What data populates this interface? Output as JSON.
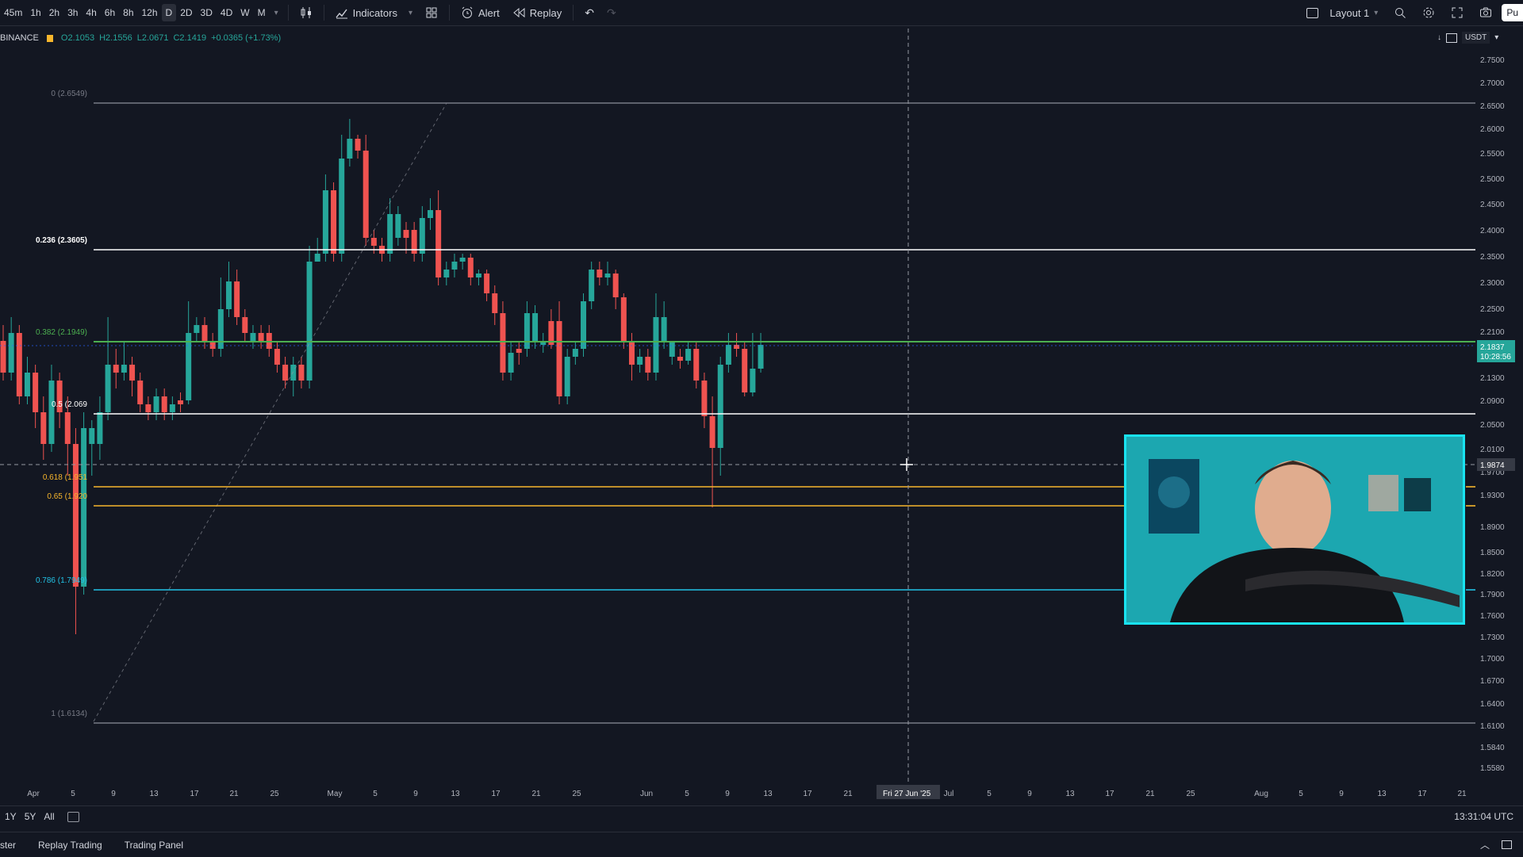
{
  "toolbar": {
    "timeframes": [
      "45m",
      "1h",
      "2h",
      "3h",
      "4h",
      "6h",
      "8h",
      "12h",
      "D",
      "2D",
      "3D",
      "4D",
      "W",
      "M"
    ],
    "active_timeframe": "D",
    "indicators_label": "Indicators",
    "alert_label": "Alert",
    "replay_label": "Replay",
    "layout_label": "Layout 1",
    "publish_label": "Pu"
  },
  "symbol": {
    "exchange": "BINANCE",
    "open": "O2.1053",
    "high": "H2.1556",
    "low": "L2.0671",
    "close": "C2.1419",
    "change": "+0.0365 (+1.73%)"
  },
  "currency": "USDT",
  "price_axis": {
    "ticks": [
      "2.7500",
      "2.7000",
      "2.6500",
      "2.6000",
      "2.5500",
      "2.5000",
      "2.4500",
      "2.4000",
      "2.3500",
      "2.3000",
      "2.2500",
      "2.2100",
      "2.1700",
      "2.1300",
      "2.0900",
      "2.0500",
      "2.0100",
      "1.9700",
      "1.9300",
      "1.8900",
      "1.8500",
      "1.8200",
      "1.7900",
      "1.7600",
      "1.7300",
      "1.7000",
      "1.6700",
      "1.6400",
      "1.6100",
      "1.5840",
      "1.5580"
    ],
    "current_price": "2.1837",
    "countdown": "10:28:56",
    "crosshair_price": "1.9874"
  },
  "time_axis": {
    "labels": [
      "Apr",
      "5",
      "9",
      "13",
      "17",
      "21",
      "25",
      "May",
      "5",
      "9",
      "13",
      "17",
      "21",
      "25",
      "Jun",
      "5",
      "9",
      "13",
      "17",
      "21",
      "Jul",
      "5",
      "9",
      "13",
      "17",
      "21",
      "25",
      "Aug",
      "5",
      "9",
      "13",
      "17",
      "21"
    ],
    "crosshair_date": "Fri 27 Jun '25"
  },
  "fib_levels": [
    {
      "label": "0 (2.6549)",
      "color": "#787b86"
    },
    {
      "label": "0.236 (2.3605)",
      "color": "#ffffff"
    },
    {
      "label": "0.382 (2.1949)",
      "color": "#4caf50"
    },
    {
      "label": "0.5 (2.069",
      "color": "#ffffff"
    },
    {
      "label": "0.618 (1.951",
      "color": "#f7b62c"
    },
    {
      "label": "0.65 (1.920",
      "color": "#f7b62c"
    },
    {
      "label": "0.786 (1.7949)",
      "color": "#22c3e6"
    },
    {
      "label": "1 (1.6134)",
      "color": "#787b86"
    }
  ],
  "range_buttons": [
    "1Y",
    "5Y",
    "All"
  ],
  "clock": "13:31:04 UTC",
  "footer_tabs": [
    "ster",
    "Replay Trading",
    "Trading Panel"
  ],
  "colors": {
    "up": "#26a69a",
    "down": "#ef5350",
    "background": "#131722",
    "accent": "#2962ff",
    "webcam_border": "#19e3f0"
  }
}
